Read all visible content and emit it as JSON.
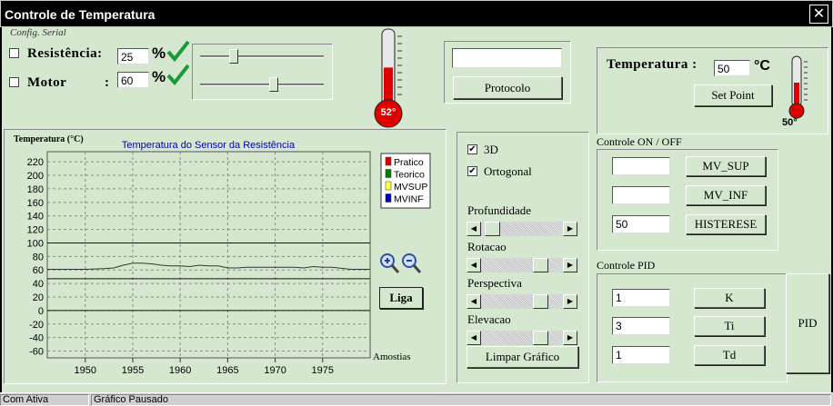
{
  "window": {
    "title": "Controle de Temperatura",
    "close_glyph": "✕"
  },
  "serial": {
    "label": "Config. Serial"
  },
  "resistencia": {
    "label": "Resistência:",
    "value": "25",
    "percent": "%",
    "checked": false,
    "slider_value": 25
  },
  "motor": {
    "label": "Motor",
    "colon": ":",
    "value": "60",
    "percent": "%",
    "checked": false,
    "slider_value": 60
  },
  "thermo_left": {
    "value_label": "52°",
    "level": 52
  },
  "protocolo": {
    "input_value": "",
    "button_label": "Protocolo"
  },
  "temperatura": {
    "label": "Temperatura :",
    "value": "50",
    "unit": "°C",
    "button_label": "Set Point",
    "thermo_label": "50°",
    "level": 50
  },
  "onoff": {
    "title": "Controle ON / OFF",
    "rows": [
      {
        "value": "",
        "button": "MV_SUP"
      },
      {
        "value": "",
        "button": "MV_INF"
      },
      {
        "value": "50",
        "button": "HISTERESE"
      }
    ]
  },
  "pid": {
    "title": "Controle PID",
    "rows": [
      {
        "value": "1",
        "button": "K"
      },
      {
        "value": "3",
        "button": "Ti"
      },
      {
        "value": "1",
        "button": "Td"
      }
    ],
    "big_button": "PID"
  },
  "options": {
    "check_3d": {
      "label": "3D",
      "checked": true,
      "glyph": "✔"
    },
    "check_ortogonal": {
      "label": "Ortogonal",
      "checked": true,
      "glyph": "✔"
    },
    "sliders": [
      {
        "label": "Profundidade",
        "value": 0.05
      },
      {
        "label": "Rotacao",
        "value": 0.78
      },
      {
        "label": "Perspectiva",
        "value": 0.78
      },
      {
        "label": "Elevacao",
        "value": 0.78
      }
    ],
    "clear_button": "Limpar Gráfico",
    "arrow_left": "◀",
    "arrow_right": "▶"
  },
  "liga_button": "Liga",
  "status": {
    "seg1": "Com Ativa",
    "seg2": "Gráfico Pausado"
  },
  "chart_data": {
    "type": "line",
    "title": "Temperatura do Sensor da Resistência",
    "ylabel": "Temperatura (°C)",
    "xlabel": "Amostias",
    "xlim": [
      1946,
      1980
    ],
    "ylim": [
      -70,
      235
    ],
    "x_ticks": [
      1950,
      1955,
      1960,
      1965,
      1970,
      1975
    ],
    "y_ticks": [
      220,
      200,
      180,
      160,
      140,
      120,
      100,
      80,
      60,
      40,
      20,
      0,
      -20,
      -40,
      -60
    ],
    "ref_lines": [
      100,
      47,
      0
    ],
    "grid": true,
    "legend": [
      "Pratico",
      "Teorico",
      "MVSUP",
      "MVINF"
    ],
    "legend_colors": [
      "#e00000",
      "#008000",
      "#ffff40",
      "#0000c0"
    ],
    "legend_position": "top-right",
    "series": [
      {
        "name": "Pratico",
        "color": "#333333",
        "x": [
          1946,
          1948,
          1950,
          1952,
          1953,
          1954,
          1955,
          1956,
          1957,
          1958,
          1959,
          1960,
          1961,
          1962,
          1963,
          1964,
          1965,
          1966,
          1967,
          1968,
          1970,
          1972,
          1973,
          1974,
          1975,
          1976,
          1978,
          1980
        ],
        "y": [
          61,
          61,
          61,
          62,
          63,
          67,
          70,
          70,
          69,
          67,
          66,
          66,
          65,
          67,
          66,
          66,
          63,
          63,
          64,
          64,
          64,
          64,
          63,
          65,
          64,
          64,
          61,
          61
        ]
      }
    ]
  }
}
